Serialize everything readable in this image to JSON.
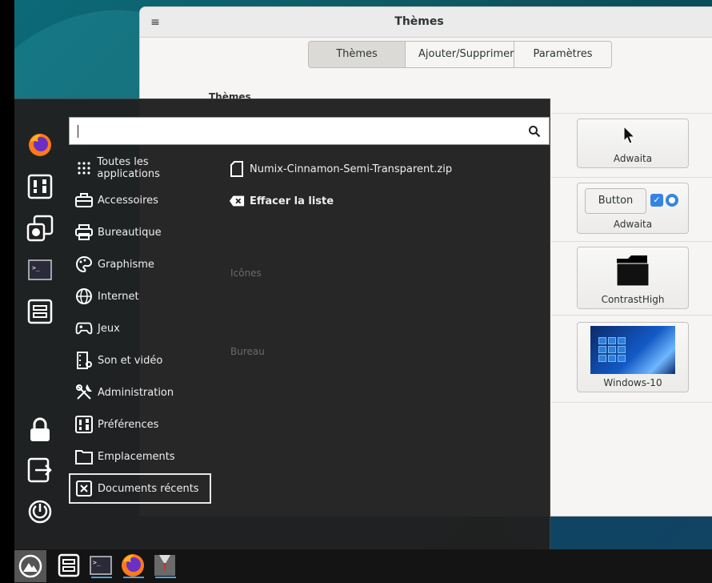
{
  "window": {
    "title": "Thèmes",
    "menu_icon": "hamburger-icon",
    "tabs": [
      "Thèmes",
      "Ajouter/Supprimer",
      "Paramètres"
    ],
    "section_heading": "Thèmes",
    "themes": [
      {
        "label": "Adwaita"
      },
      {
        "label": "Adwaita",
        "button_label": "Button"
      },
      {
        "label": "ContrastHigh"
      },
      {
        "label": "Windows-10"
      }
    ],
    "hidden_labels": [
      "Icônes",
      "Bureau"
    ]
  },
  "menu": {
    "search_value": "",
    "categories": [
      {
        "label": "Toutes les applications",
        "icon": "grid-icon"
      },
      {
        "label": "Accessoires",
        "icon": "toolbox-icon"
      },
      {
        "label": "Bureautique",
        "icon": "printer-icon"
      },
      {
        "label": "Graphisme",
        "icon": "palette-icon"
      },
      {
        "label": "Internet",
        "icon": "globe-icon"
      },
      {
        "label": "Jeux",
        "icon": "gamepad-icon"
      },
      {
        "label": "Son et vidéo",
        "icon": "film-icon"
      },
      {
        "label": "Administration",
        "icon": "tools-icon"
      },
      {
        "label": "Préférences",
        "icon": "sliders-icon"
      },
      {
        "label": "Emplacements",
        "icon": "folder-icon"
      },
      {
        "label": "Documents récents",
        "icon": "recent-docs-icon"
      }
    ],
    "recent": [
      {
        "label": "Numix-Cinnamon-Semi-Transparent.zip",
        "icon": "file-icon"
      },
      {
        "label": "Effacer la liste",
        "icon": "clear-icon"
      }
    ],
    "sidebar_icons": [
      "firefox-icon",
      "settings-icon",
      "software-icon",
      "terminal-icon",
      "file-cabinet-icon",
      "lock-icon",
      "logout-icon",
      "power-icon"
    ]
  },
  "taskbar": {
    "items": [
      "menu-icon",
      "file-cabinet-icon",
      "terminal-icon",
      "firefox-icon",
      "theme-app-icon"
    ]
  }
}
